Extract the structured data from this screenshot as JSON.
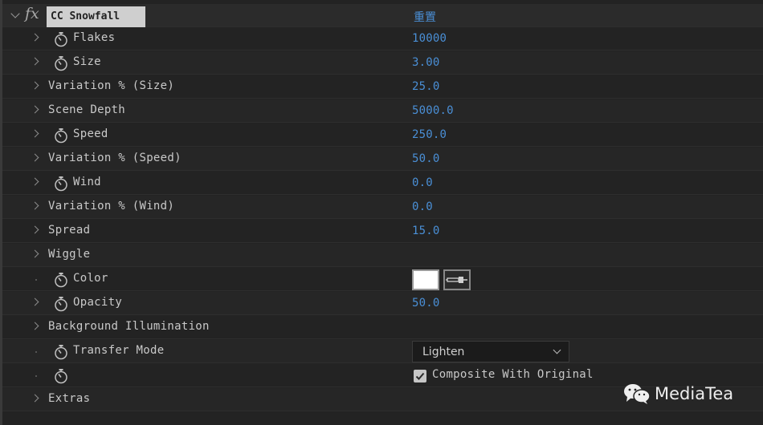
{
  "effect": {
    "name": "CC Snowfall",
    "reset_label": "重置",
    "fx_symbol": "fx"
  },
  "rows": [
    {
      "label": "Flakes",
      "value": "10000"
    },
    {
      "label": "Size",
      "value": "3.00"
    },
    {
      "label": "Variation % (Size)",
      "value": "25.0"
    },
    {
      "label": "Scene Depth",
      "value": "5000.0"
    },
    {
      "label": "Speed",
      "value": "250.0"
    },
    {
      "label": "Variation % (Speed)",
      "value": "50.0"
    },
    {
      "label": "Wind",
      "value": "0.0"
    },
    {
      "label": "Variation % (Wind)",
      "value": "0.0"
    },
    {
      "label": "Spread",
      "value": "15.0"
    },
    {
      "label": "Wiggle"
    },
    {
      "label": "Color",
      "swatch_color": "#ffffff"
    },
    {
      "label": "Opacity",
      "value": "50.0"
    },
    {
      "label": "Background Illumination"
    },
    {
      "label": "Transfer Mode",
      "selected": "Lighten"
    },
    {
      "checkbox_label": "Composite With Original",
      "checked": true
    },
    {
      "label": "Extras"
    }
  ],
  "watermark": "MediaTea",
  "colors": {
    "value_blue": "#4a8fd6",
    "background": "#232323",
    "text": "#c9c9c9"
  }
}
